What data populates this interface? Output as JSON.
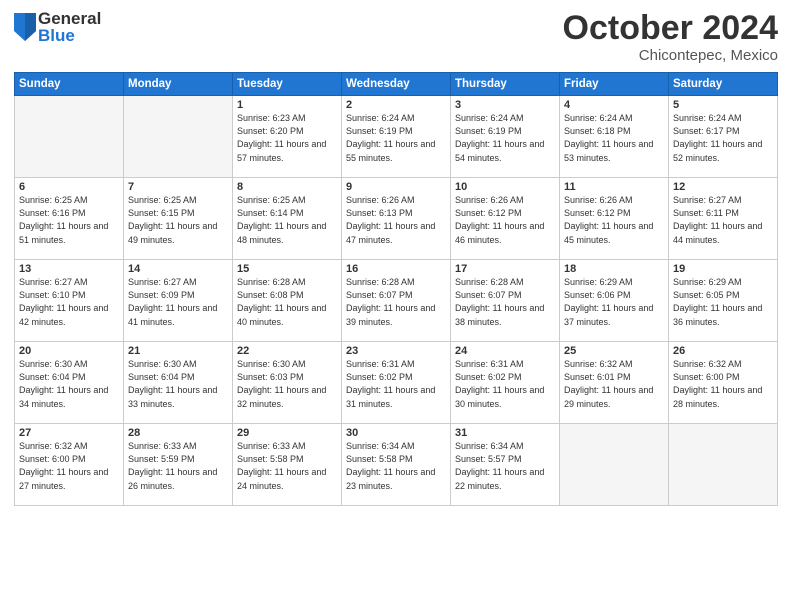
{
  "header": {
    "logo_general": "General",
    "logo_blue": "Blue",
    "month": "October 2024",
    "location": "Chicontepec, Mexico"
  },
  "weekdays": [
    "Sunday",
    "Monday",
    "Tuesday",
    "Wednesday",
    "Thursday",
    "Friday",
    "Saturday"
  ],
  "weeks": [
    [
      {
        "day": "",
        "info": ""
      },
      {
        "day": "",
        "info": ""
      },
      {
        "day": "1",
        "info": "Sunrise: 6:23 AM\nSunset: 6:20 PM\nDaylight: 11 hours\nand 57 minutes."
      },
      {
        "day": "2",
        "info": "Sunrise: 6:24 AM\nSunset: 6:19 PM\nDaylight: 11 hours\nand 55 minutes."
      },
      {
        "day": "3",
        "info": "Sunrise: 6:24 AM\nSunset: 6:19 PM\nDaylight: 11 hours\nand 54 minutes."
      },
      {
        "day": "4",
        "info": "Sunrise: 6:24 AM\nSunset: 6:18 PM\nDaylight: 11 hours\nand 53 minutes."
      },
      {
        "day": "5",
        "info": "Sunrise: 6:24 AM\nSunset: 6:17 PM\nDaylight: 11 hours\nand 52 minutes."
      }
    ],
    [
      {
        "day": "6",
        "info": "Sunrise: 6:25 AM\nSunset: 6:16 PM\nDaylight: 11 hours\nand 51 minutes."
      },
      {
        "day": "7",
        "info": "Sunrise: 6:25 AM\nSunset: 6:15 PM\nDaylight: 11 hours\nand 49 minutes."
      },
      {
        "day": "8",
        "info": "Sunrise: 6:25 AM\nSunset: 6:14 PM\nDaylight: 11 hours\nand 48 minutes."
      },
      {
        "day": "9",
        "info": "Sunrise: 6:26 AM\nSunset: 6:13 PM\nDaylight: 11 hours\nand 47 minutes."
      },
      {
        "day": "10",
        "info": "Sunrise: 6:26 AM\nSunset: 6:12 PM\nDaylight: 11 hours\nand 46 minutes."
      },
      {
        "day": "11",
        "info": "Sunrise: 6:26 AM\nSunset: 6:12 PM\nDaylight: 11 hours\nand 45 minutes."
      },
      {
        "day": "12",
        "info": "Sunrise: 6:27 AM\nSunset: 6:11 PM\nDaylight: 11 hours\nand 44 minutes."
      }
    ],
    [
      {
        "day": "13",
        "info": "Sunrise: 6:27 AM\nSunset: 6:10 PM\nDaylight: 11 hours\nand 42 minutes."
      },
      {
        "day": "14",
        "info": "Sunrise: 6:27 AM\nSunset: 6:09 PM\nDaylight: 11 hours\nand 41 minutes."
      },
      {
        "day": "15",
        "info": "Sunrise: 6:28 AM\nSunset: 6:08 PM\nDaylight: 11 hours\nand 40 minutes."
      },
      {
        "day": "16",
        "info": "Sunrise: 6:28 AM\nSunset: 6:07 PM\nDaylight: 11 hours\nand 39 minutes."
      },
      {
        "day": "17",
        "info": "Sunrise: 6:28 AM\nSunset: 6:07 PM\nDaylight: 11 hours\nand 38 minutes."
      },
      {
        "day": "18",
        "info": "Sunrise: 6:29 AM\nSunset: 6:06 PM\nDaylight: 11 hours\nand 37 minutes."
      },
      {
        "day": "19",
        "info": "Sunrise: 6:29 AM\nSunset: 6:05 PM\nDaylight: 11 hours\nand 36 minutes."
      }
    ],
    [
      {
        "day": "20",
        "info": "Sunrise: 6:30 AM\nSunset: 6:04 PM\nDaylight: 11 hours\nand 34 minutes."
      },
      {
        "day": "21",
        "info": "Sunrise: 6:30 AM\nSunset: 6:04 PM\nDaylight: 11 hours\nand 33 minutes."
      },
      {
        "day": "22",
        "info": "Sunrise: 6:30 AM\nSunset: 6:03 PM\nDaylight: 11 hours\nand 32 minutes."
      },
      {
        "day": "23",
        "info": "Sunrise: 6:31 AM\nSunset: 6:02 PM\nDaylight: 11 hours\nand 31 minutes."
      },
      {
        "day": "24",
        "info": "Sunrise: 6:31 AM\nSunset: 6:02 PM\nDaylight: 11 hours\nand 30 minutes."
      },
      {
        "day": "25",
        "info": "Sunrise: 6:32 AM\nSunset: 6:01 PM\nDaylight: 11 hours\nand 29 minutes."
      },
      {
        "day": "26",
        "info": "Sunrise: 6:32 AM\nSunset: 6:00 PM\nDaylight: 11 hours\nand 28 minutes."
      }
    ],
    [
      {
        "day": "27",
        "info": "Sunrise: 6:32 AM\nSunset: 6:00 PM\nDaylight: 11 hours\nand 27 minutes."
      },
      {
        "day": "28",
        "info": "Sunrise: 6:33 AM\nSunset: 5:59 PM\nDaylight: 11 hours\nand 26 minutes."
      },
      {
        "day": "29",
        "info": "Sunrise: 6:33 AM\nSunset: 5:58 PM\nDaylight: 11 hours\nand 24 minutes."
      },
      {
        "day": "30",
        "info": "Sunrise: 6:34 AM\nSunset: 5:58 PM\nDaylight: 11 hours\nand 23 minutes."
      },
      {
        "day": "31",
        "info": "Sunrise: 6:34 AM\nSunset: 5:57 PM\nDaylight: 11 hours\nand 22 minutes."
      },
      {
        "day": "",
        "info": ""
      },
      {
        "day": "",
        "info": ""
      }
    ]
  ]
}
